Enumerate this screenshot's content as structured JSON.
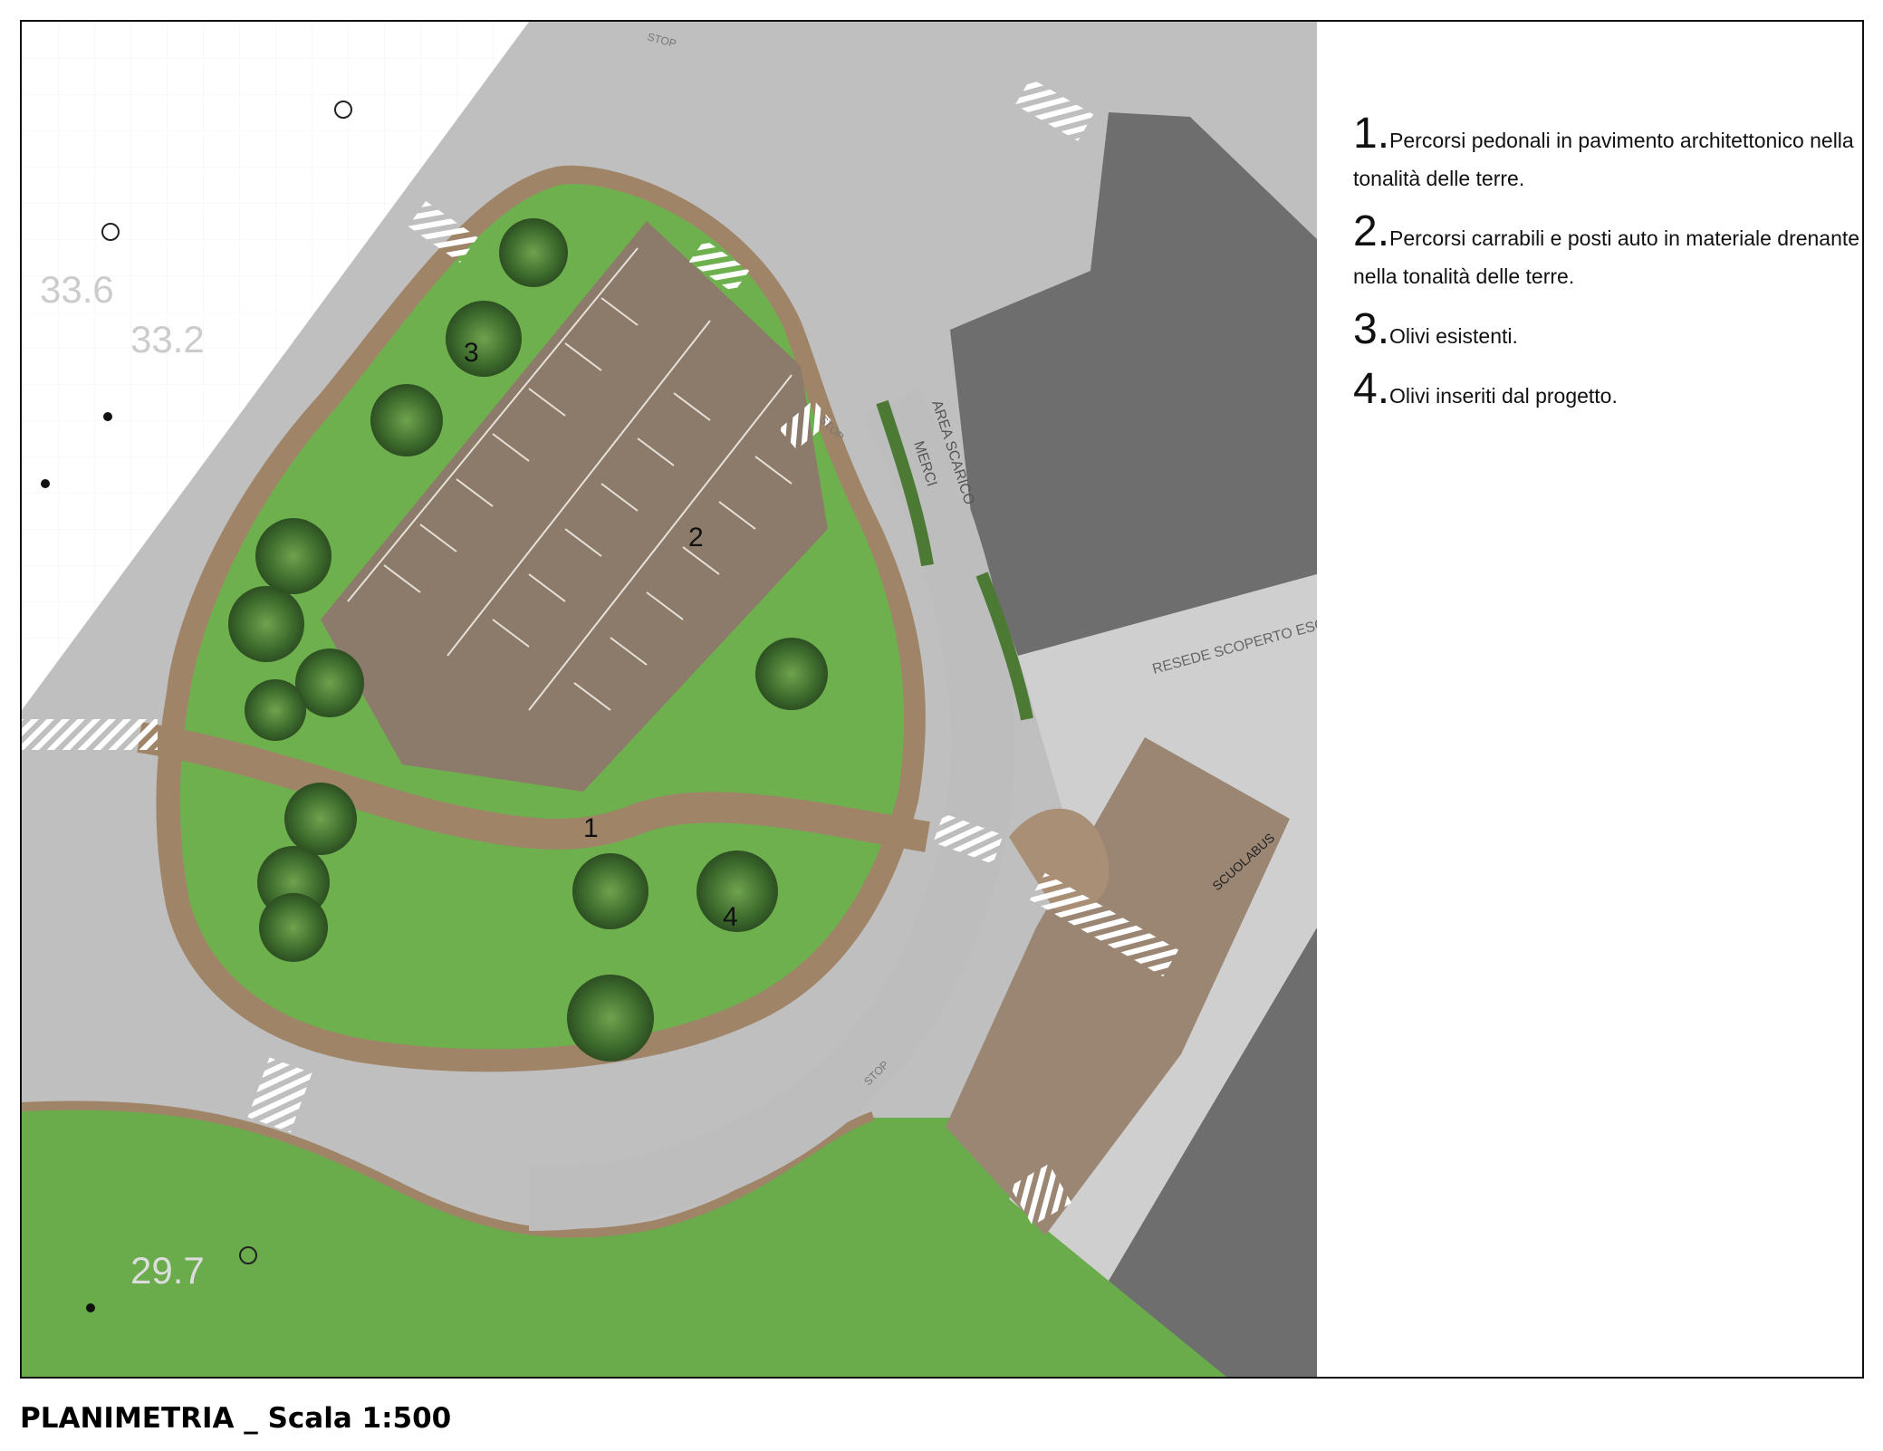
{
  "map": {
    "area_numbers": [
      "1",
      "2",
      "3",
      "4"
    ],
    "elevations": [
      "33.6",
      "33.2",
      "29.7"
    ],
    "road_labels": {
      "stop": "STOP",
      "area_scarico": "AREA SCARICO",
      "merci": "MERCI",
      "resede": "RESEDE SCOPERTO ESCL",
      "scuolabus": "SCUOLABUS"
    },
    "colors": {
      "road": "#bdbdbd",
      "road_dark": "#a9a9a9",
      "grass": "#6aa84f",
      "grass_light": "#7cbf5c",
      "brown_path": "#a08468",
      "parking": "#8e7d6d",
      "building": "#6d6d6d",
      "tree": "#3d6b2e"
    }
  },
  "legend": [
    {
      "num": "1.",
      "text": "Percorsi pedonali in pavimento architettonico nella tonalità delle terre."
    },
    {
      "num": "2.",
      "text": "Percorsi carrabili e posti auto in materiale drenante nella tonalità delle terre."
    },
    {
      "num": "3.",
      "text": "Olivi esistenti."
    },
    {
      "num": "4.",
      "text": "Olivi inseriti dal progetto."
    }
  ],
  "title": "PLANIMETRIA _ Scala 1:500"
}
